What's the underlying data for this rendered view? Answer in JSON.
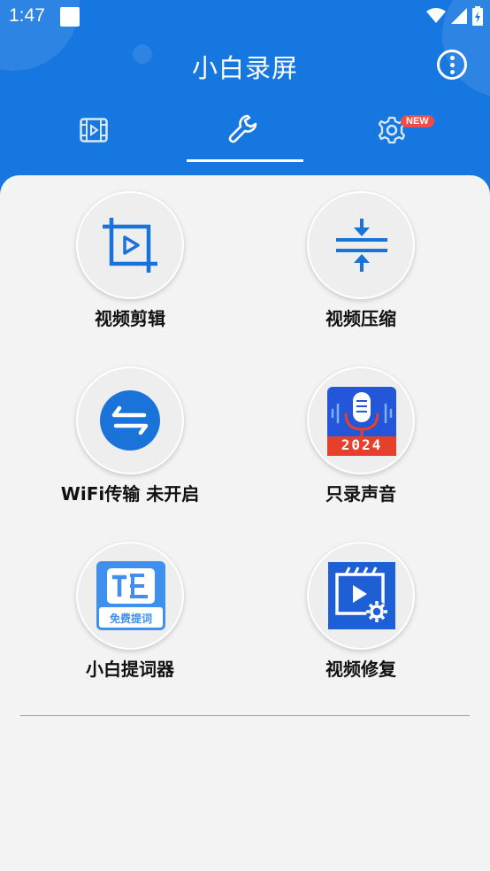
{
  "status_bar": {
    "time": "1:47"
  },
  "app": {
    "title": "小白录屏"
  },
  "tabs": [
    {
      "name": "videos",
      "icon": "film-icon"
    },
    {
      "name": "tools",
      "icon": "wrench-icon",
      "selected": true
    },
    {
      "name": "settings",
      "icon": "gear-icon",
      "badge": "NEW"
    }
  ],
  "tools": [
    {
      "label": "视频剪辑",
      "icon": "video-crop-icon"
    },
    {
      "label": "视频压缩",
      "icon": "compress-icon"
    },
    {
      "label": "WiFi传输 未开启",
      "icon": "transfer-arrows-icon"
    },
    {
      "label": "只录声音",
      "icon": "microphone-2024-icon",
      "icon_text": "2024"
    },
    {
      "label": "小白提词器",
      "icon": "teleprompter-icon",
      "icon_text": "免费提词"
    },
    {
      "label": "视频修复",
      "icon": "video-repair-icon"
    }
  ],
  "colors": {
    "header_blue": "#1677e0",
    "icon_blue": "#1a73d9",
    "badge_red": "#ef4b4b",
    "mic_red": "#e5402a"
  }
}
